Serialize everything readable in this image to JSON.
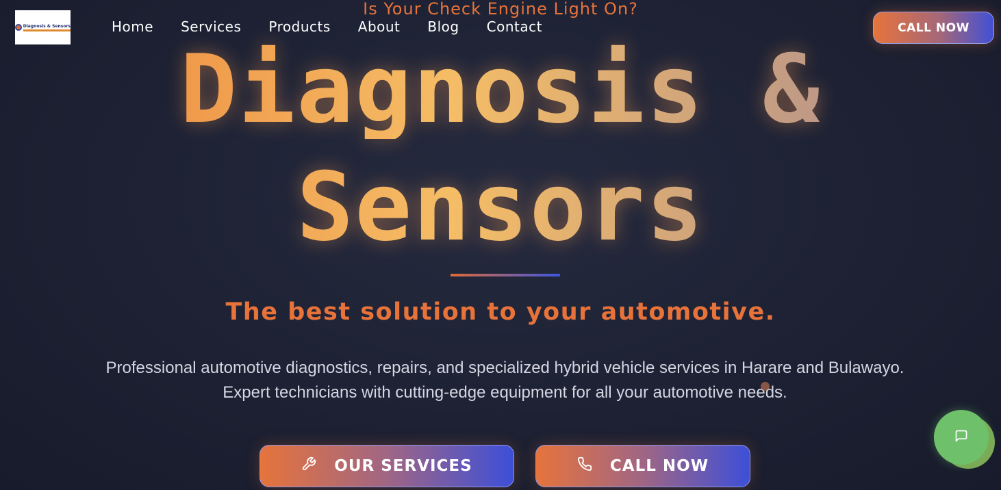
{
  "logo": {
    "text": "Diagnosis & Sensors"
  },
  "banner": "Is Your Check Engine Light On?",
  "nav": {
    "items": [
      {
        "label": "Home"
      },
      {
        "label": "Services"
      },
      {
        "label": "Products"
      },
      {
        "label": "About"
      },
      {
        "label": "Blog"
      },
      {
        "label": "Contact"
      }
    ]
  },
  "header": {
    "call_label": "CALL NOW"
  },
  "hero": {
    "title_line1": "Diagnosis &",
    "title_line2": "Sensors",
    "tagline": "The best solution to your automotive.",
    "description": "Professional automotive diagnostics, repairs, and specialized hybrid vehicle services in Harare and Bulawayo. Expert technicians with cutting-edge equipment for all your automotive needs.",
    "services_button": "OUR SERVICES",
    "call_button": "CALL NOW"
  },
  "icons": {
    "services": "wrench-icon",
    "call": "phone-icon",
    "chat": "chat-bubble-icon"
  },
  "colors": {
    "accent": "#e8733a",
    "brand_blue": "#3d4fd8",
    "chat_green": "#6fc06b",
    "background": "#1d2133"
  }
}
